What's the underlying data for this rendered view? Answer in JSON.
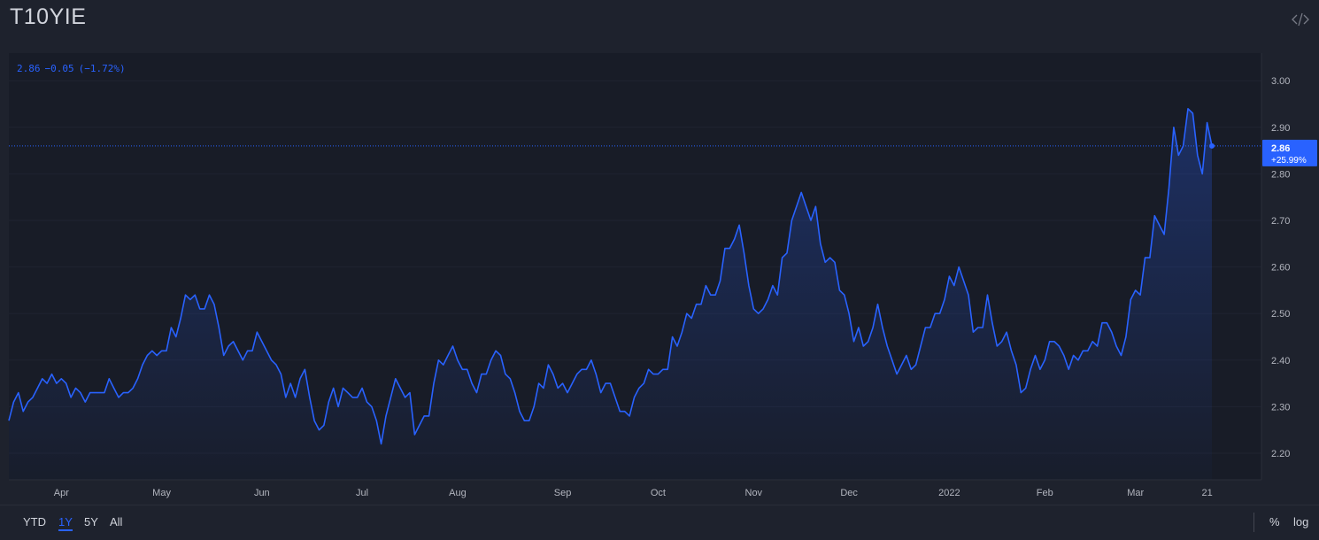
{
  "header": {
    "symbol": "T10YIE"
  },
  "legend": {
    "value": "2.86",
    "change": "−0.05",
    "change_pct": "(−1.72%)"
  },
  "last_price_label": {
    "value": "2.86",
    "change_pct": "+25.99%"
  },
  "range_buttons": [
    {
      "label": "YTD",
      "active": false
    },
    {
      "label": "1Y",
      "active": true
    },
    {
      "label": "5Y",
      "active": false
    },
    {
      "label": "All",
      "active": false
    }
  ],
  "footer_right": {
    "percent": "%",
    "log": "log"
  },
  "colors": {
    "background": "#1e222d",
    "line": "#2962ff",
    "grid": "#2a2e39",
    "axis_text": "#b2b5be"
  },
  "chart_data": {
    "type": "area",
    "title": "",
    "xlabel": "",
    "ylabel": "",
    "ylim": [
      2.15,
      3.05
    ],
    "y_ticks": [
      2.2,
      2.3,
      2.4,
      2.5,
      2.6,
      2.7,
      2.8,
      2.9,
      3.0
    ],
    "y_tick_labels": [
      "2.20",
      "2.30",
      "2.40",
      "2.50",
      "2.60",
      "2.70",
      "2.80",
      "2.90",
      "3.00"
    ],
    "x_ticks": [
      {
        "label": "Apr",
        "index": 11
      },
      {
        "label": "May",
        "index": 32
      },
      {
        "label": "Jun",
        "index": 53
      },
      {
        "label": "Jul",
        "index": 74
      },
      {
        "label": "Aug",
        "index": 94
      },
      {
        "label": "Sep",
        "index": 116
      },
      {
        "label": "Oct",
        "index": 136
      },
      {
        "label": "Nov",
        "index": 156
      },
      {
        "label": "Dec",
        "index": 176
      },
      {
        "label": "2022",
        "index": 197
      },
      {
        "label": "Feb",
        "index": 217
      },
      {
        "label": "Mar",
        "index": 236
      },
      {
        "label": "21",
        "index": 251
      }
    ],
    "last_value": 2.86,
    "series": [
      {
        "values": [
          2.27,
          2.31,
          2.33,
          2.29,
          2.31,
          2.32,
          2.34,
          2.36,
          2.35,
          2.37,
          2.35,
          2.36,
          2.35,
          2.32,
          2.34,
          2.33,
          2.31,
          2.33,
          2.33,
          2.33,
          2.33,
          2.36,
          2.34,
          2.32,
          2.33,
          2.33,
          2.34,
          2.36,
          2.39,
          2.41,
          2.42,
          2.41,
          2.42,
          2.42,
          2.47,
          2.45,
          2.49,
          2.54,
          2.53,
          2.54,
          2.51,
          2.51,
          2.54,
          2.52,
          2.47,
          2.41,
          2.43,
          2.44,
          2.42,
          2.4,
          2.42,
          2.42,
          2.46,
          2.44,
          2.42,
          2.4,
          2.39,
          2.37,
          2.32,
          2.35,
          2.32,
          2.36,
          2.38,
          2.32,
          2.27,
          2.25,
          2.26,
          2.31,
          2.34,
          2.3,
          2.34,
          2.33,
          2.32,
          2.32,
          2.34,
          2.31,
          2.3,
          2.27,
          2.22,
          2.28,
          2.32,
          2.36,
          2.34,
          2.32,
          2.33,
          2.24,
          2.26,
          2.28,
          2.28,
          2.35,
          2.4,
          2.39,
          2.41,
          2.43,
          2.4,
          2.38,
          2.38,
          2.35,
          2.33,
          2.37,
          2.37,
          2.4,
          2.42,
          2.41,
          2.37,
          2.36,
          2.33,
          2.29,
          2.27,
          2.27,
          2.3,
          2.35,
          2.34,
          2.39,
          2.37,
          2.34,
          2.35,
          2.33,
          2.35,
          2.37,
          2.38,
          2.38,
          2.4,
          2.37,
          2.33,
          2.35,
          2.35,
          2.32,
          2.29,
          2.29,
          2.28,
          2.32,
          2.34,
          2.35,
          2.38,
          2.37,
          2.37,
          2.38,
          2.38,
          2.45,
          2.43,
          2.46,
          2.5,
          2.49,
          2.52,
          2.52,
          2.56,
          2.54,
          2.54,
          2.57,
          2.64,
          2.64,
          2.66,
          2.69,
          2.63,
          2.56,
          2.51,
          2.5,
          2.51,
          2.53,
          2.56,
          2.54,
          2.62,
          2.63,
          2.7,
          2.73,
          2.76,
          2.73,
          2.7,
          2.73,
          2.65,
          2.61,
          2.62,
          2.61,
          2.55,
          2.54,
          2.5,
          2.44,
          2.47,
          2.43,
          2.44,
          2.47,
          2.52,
          2.47,
          2.43,
          2.4,
          2.37,
          2.39,
          2.41,
          2.38,
          2.39,
          2.43,
          2.47,
          2.47,
          2.5,
          2.5,
          2.53,
          2.58,
          2.56,
          2.6,
          2.57,
          2.54,
          2.46,
          2.47,
          2.47,
          2.54,
          2.48,
          2.43,
          2.44,
          2.46,
          2.42,
          2.39,
          2.33,
          2.34,
          2.38,
          2.41,
          2.38,
          2.4,
          2.44,
          2.44,
          2.43,
          2.41,
          2.38,
          2.41,
          2.4,
          2.42,
          2.42,
          2.44,
          2.43,
          2.48,
          2.48,
          2.46,
          2.43,
          2.41,
          2.45,
          2.53,
          2.55,
          2.54,
          2.62,
          2.62,
          2.71,
          2.69,
          2.67,
          2.77,
          2.9,
          2.84,
          2.86,
          2.94,
          2.93,
          2.84,
          2.8,
          2.91,
          2.86
        ]
      }
    ]
  }
}
